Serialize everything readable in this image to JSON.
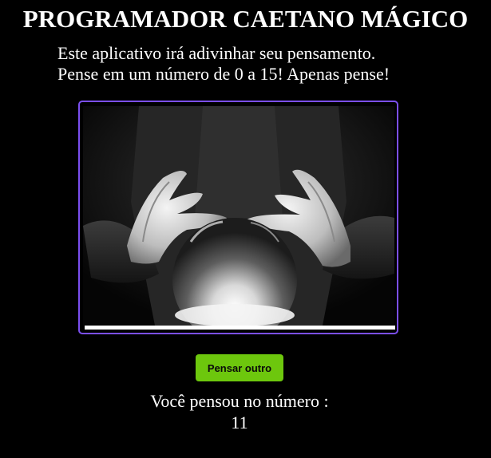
{
  "header": {
    "title": "PROGRAMADOR CAETANO MÁGICO"
  },
  "intro": {
    "line1": "Este aplicativo irá adivinhar seu pensamento.",
    "line2": "Pense em um número de 0 a 15! Apenas pense!"
  },
  "image": {
    "subject": "crystal-ball-hands",
    "frame_color": "#7b4ff0",
    "progress_percent": 100
  },
  "actions": {
    "think_again_label": "Pensar outro",
    "button_color": "#6dc70d"
  },
  "result": {
    "label": "Você pensou no número :",
    "number": "11"
  }
}
